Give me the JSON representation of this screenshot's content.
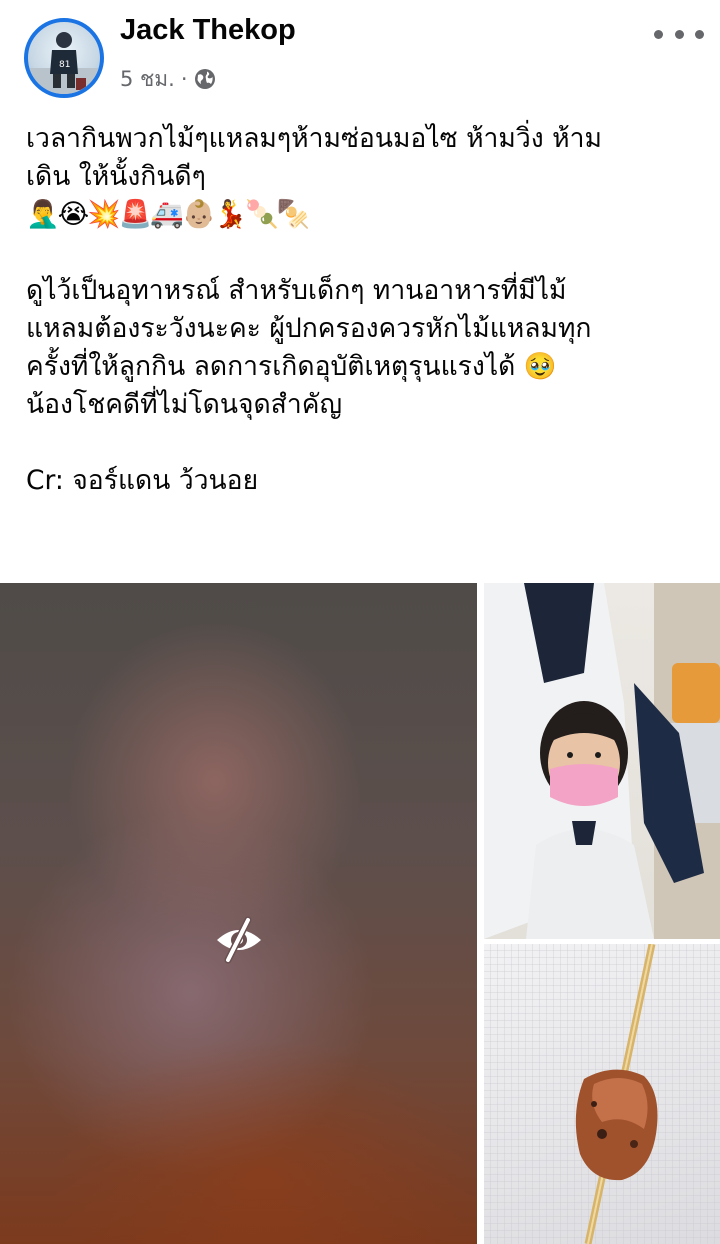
{
  "post": {
    "author": "Jack Thekop",
    "time": "5 ชม.",
    "separator": "·",
    "privacy_icon": "globe-icon",
    "more_icon": "ellipsis-icon",
    "lines": {
      "l1": "เวลากินพวกไม้ๆแหลมๆห้ามซ่อนมอไซ ห้ามวิ่ง ห้าม",
      "l2": "เดิน ให้นั้งกินดีๆ",
      "emojis": "🤦‍♂️😭💥🚨🚑👶🏼💃🍡🍢",
      "l3": "ดูไว้เป็นอุทาหรณ์ สำหรับเด็กๆ ทานอาหารที่มีไม้",
      "l4": "แหลมต้องระวังนะคะ ผู้ปกครองควรหักไม้แหลมทุก",
      "l5": "ครั้งที่ให้ลูกกิน ลดการเกิดอุบัติเหตุรุนแรงได้ 🥹",
      "l6": "น้องโชคดีที่ไม่โดนจุดสำคัญ",
      "l7": "Cr: จอร์แดน ว้วนอย"
    }
  },
  "photos": {
    "main_hidden_icon": "eye-slash-icon",
    "accent_blue": "#1b74e4",
    "mask_pink": "#f3a3c6"
  }
}
